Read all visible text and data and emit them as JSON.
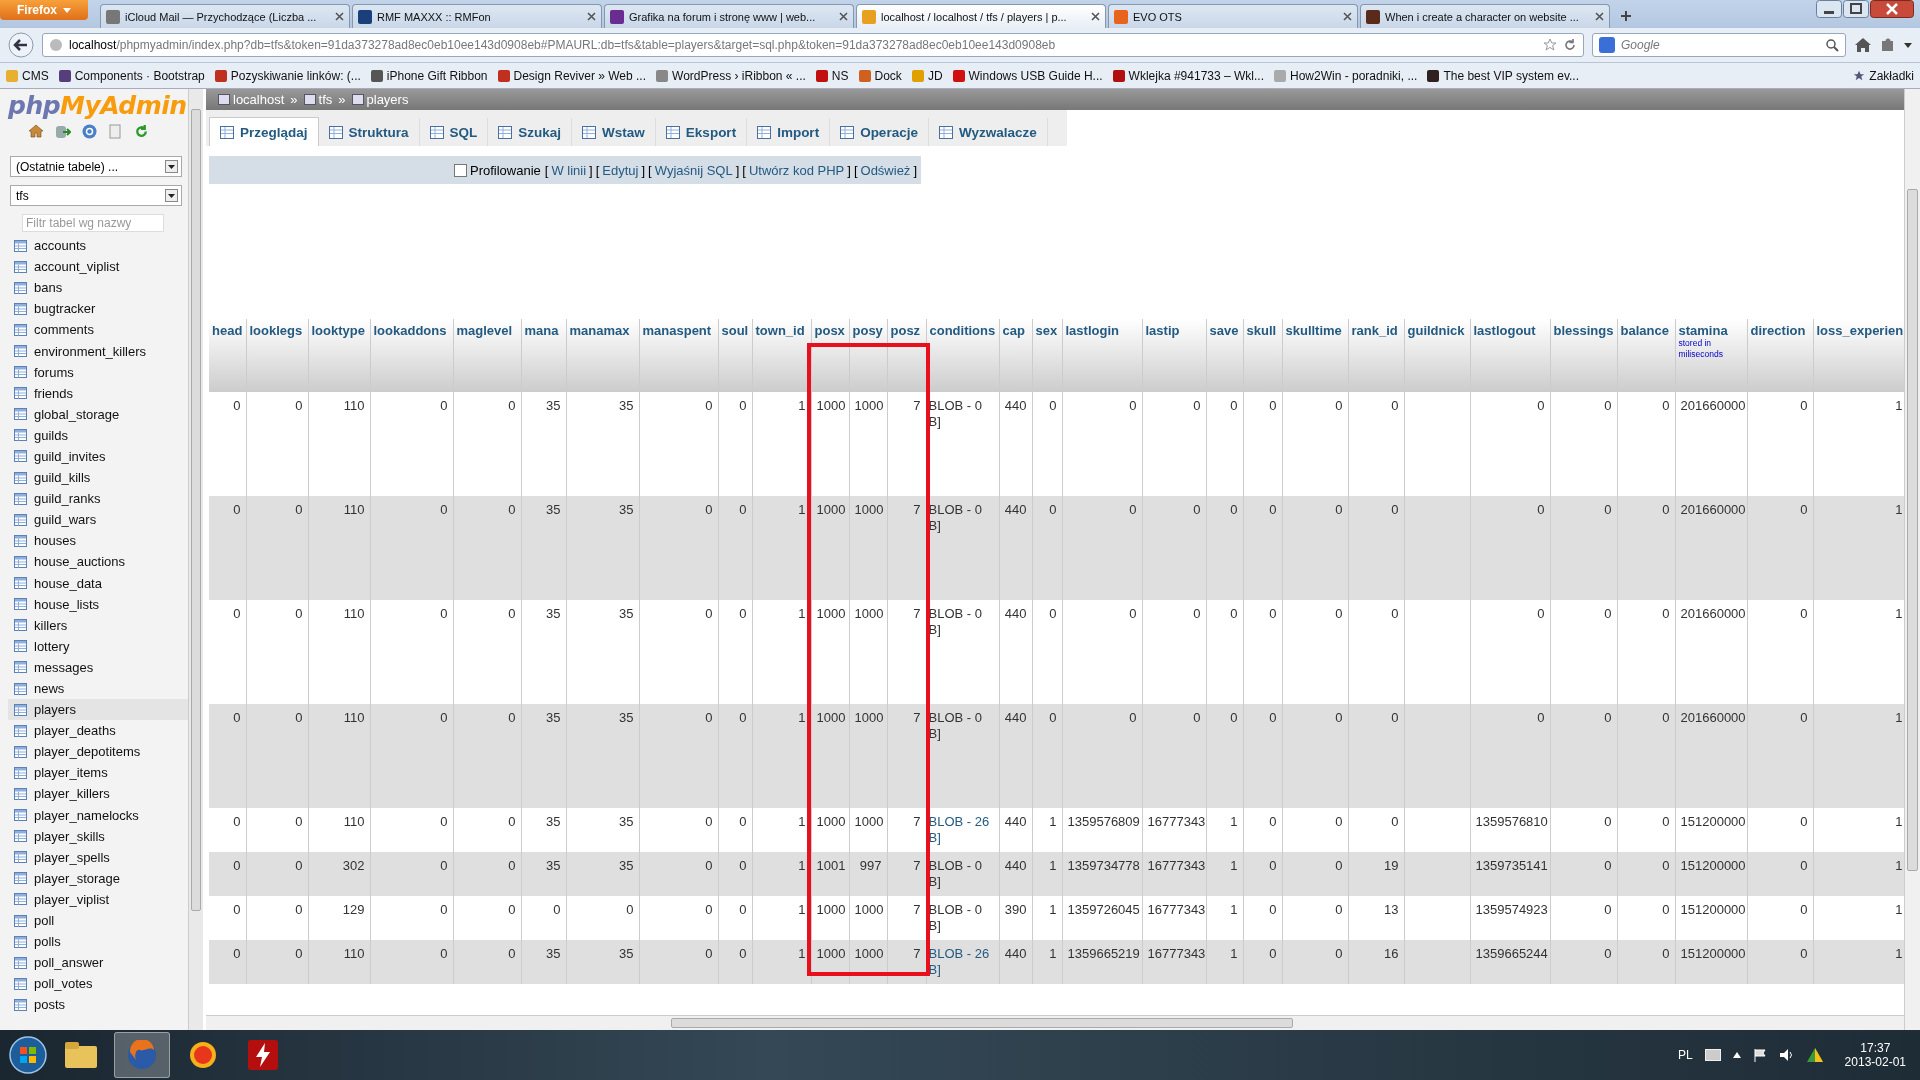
{
  "browser": {
    "app_button": "Firefox",
    "tabs": [
      {
        "title": "iCloud Mail — Przychodzące (Liczba ...",
        "selected": false
      },
      {
        "title": "RMF MAXXX :: RMFon",
        "selected": false
      },
      {
        "title": "Grafika na forum i stronę www | web...",
        "selected": false
      },
      {
        "title": "localhost / localhost / tfs / players | p...",
        "selected": true
      },
      {
        "title": "EVO OTS",
        "selected": false
      },
      {
        "title": "When i create a character on website ...",
        "selected": false
      }
    ],
    "url_host": "localhost",
    "url_rest": "/phpmyadmin/index.php?db=tfs&token=91da373278ad8ec0eb10ee143d0908eb#PMAURL:db=tfs&table=players&target=sql.php&token=91da373278ad8ec0eb10ee143d0908eb",
    "search_placeholder": "Google",
    "bookmarks": [
      "CMS",
      "Components · Bootstrap",
      "Pozyskiwanie linków: (...",
      "iPhone Gift Ribbon",
      "Design Reviver » Web ...",
      "WordPress › iRibbon « ...",
      "NS",
      "Dock",
      "JD",
      "Windows USB Guide H...",
      "Wklejka #941733 – Wkl...",
      "How2Win - poradniki, ...",
      "The best VIP system ev..."
    ],
    "bookmarks_menu": "Zakładki"
  },
  "sidebar": {
    "logo": [
      "php",
      "MyAdmin"
    ],
    "recent_select": "(Ostatnie tabele) ...",
    "db_select": "tfs",
    "filter_placeholder": "Filtr tabel wg nazwy",
    "tables": [
      {
        "name": "accounts",
        "selected": false
      },
      {
        "name": "account_viplist",
        "selected": false
      },
      {
        "name": "bans",
        "selected": false
      },
      {
        "name": "bugtracker",
        "selected": false
      },
      {
        "name": "comments",
        "selected": false
      },
      {
        "name": "environment_killers",
        "selected": false
      },
      {
        "name": "forums",
        "selected": false
      },
      {
        "name": "friends",
        "selected": false
      },
      {
        "name": "global_storage",
        "selected": false
      },
      {
        "name": "guilds",
        "selected": false
      },
      {
        "name": "guild_invites",
        "selected": false
      },
      {
        "name": "guild_kills",
        "selected": false
      },
      {
        "name": "guild_ranks",
        "selected": false
      },
      {
        "name": "guild_wars",
        "selected": false
      },
      {
        "name": "houses",
        "selected": false
      },
      {
        "name": "house_auctions",
        "selected": false
      },
      {
        "name": "house_data",
        "selected": false
      },
      {
        "name": "house_lists",
        "selected": false
      },
      {
        "name": "killers",
        "selected": false
      },
      {
        "name": "lottery",
        "selected": false
      },
      {
        "name": "messages",
        "selected": false
      },
      {
        "name": "news",
        "selected": false
      },
      {
        "name": "players",
        "selected": true
      },
      {
        "name": "player_deaths",
        "selected": false
      },
      {
        "name": "player_depotitems",
        "selected": false
      },
      {
        "name": "player_items",
        "selected": false
      },
      {
        "name": "player_killers",
        "selected": false
      },
      {
        "name": "player_namelocks",
        "selected": false
      },
      {
        "name": "player_skills",
        "selected": false
      },
      {
        "name": "player_spells",
        "selected": false
      },
      {
        "name": "player_storage",
        "selected": false
      },
      {
        "name": "player_viplist",
        "selected": false
      },
      {
        "name": "poll",
        "selected": false
      },
      {
        "name": "polls",
        "selected": false
      },
      {
        "name": "poll_answer",
        "selected": false
      },
      {
        "name": "poll_votes",
        "selected": false
      },
      {
        "name": "posts",
        "selected": false
      }
    ]
  },
  "breadcrumb": [
    "localhost",
    "tfs",
    "players"
  ],
  "breadcrumb_separator": "»",
  "tabs": [
    {
      "label": "Przeglądaj",
      "selected": true
    },
    {
      "label": "Struktura",
      "selected": false
    },
    {
      "label": "SQL",
      "selected": false
    },
    {
      "label": "Szukaj",
      "selected": false
    },
    {
      "label": "Wstaw",
      "selected": false
    },
    {
      "label": "Eksport",
      "selected": false
    },
    {
      "label": "Import",
      "selected": false
    },
    {
      "label": "Operacje",
      "selected": false
    },
    {
      "label": "Wyzwalacze",
      "selected": false
    }
  ],
  "profiling": {
    "label": "Profilowanie",
    "checked": false,
    "brackets": [
      "[",
      "]"
    ],
    "links": [
      "W linii",
      "Edytuj",
      "Wyjaśnij SQL",
      "Utwórz kod PHP",
      "Odśwież"
    ]
  },
  "table": {
    "columns": [
      {
        "name": "head"
      },
      {
        "name": "looklegs"
      },
      {
        "name": "looktype"
      },
      {
        "name": "lookaddons"
      },
      {
        "name": "maglevel"
      },
      {
        "name": "mana"
      },
      {
        "name": "manamax"
      },
      {
        "name": "manaspent"
      },
      {
        "name": "soul"
      },
      {
        "name": "town_id"
      },
      {
        "name": "posx",
        "highlighted": true
      },
      {
        "name": "posy",
        "highlighted": true
      },
      {
        "name": "posz",
        "highlighted": true
      },
      {
        "name": "conditions"
      },
      {
        "name": "cap"
      },
      {
        "name": "sex"
      },
      {
        "name": "lastlogin"
      },
      {
        "name": "lastip"
      },
      {
        "name": "save"
      },
      {
        "name": "skull"
      },
      {
        "name": "skulltime"
      },
      {
        "name": "rank_id"
      },
      {
        "name": "guildnick"
      },
      {
        "name": "lastlogout"
      },
      {
        "name": "blessings"
      },
      {
        "name": "balance"
      },
      {
        "name": "stamina",
        "note": "stored in miliseconds"
      },
      {
        "name": "direction"
      },
      {
        "name": "loss_experien"
      }
    ],
    "rows": [
      {
        "tall": true,
        "cells": [
          "0",
          "0",
          "110",
          "0",
          "0",
          "35",
          "35",
          "0",
          "0",
          "1",
          "1000",
          "1000",
          "7",
          {
            "text": "BLOB - 0 B]",
            "link": false
          },
          "440",
          "0",
          "0",
          "0",
          "0",
          "0",
          "0",
          "0",
          null,
          "0",
          "0",
          "0",
          "201660000",
          "0",
          "1"
        ]
      },
      {
        "tall": true,
        "cells": [
          "0",
          "0",
          "110",
          "0",
          "0",
          "35",
          "35",
          "0",
          "0",
          "1",
          "1000",
          "1000",
          "7",
          {
            "text": "BLOB - 0 B]",
            "link": false
          },
          "440",
          "0",
          "0",
          "0",
          "0",
          "0",
          "0",
          "0",
          null,
          "0",
          "0",
          "0",
          "201660000",
          "0",
          "1"
        ]
      },
      {
        "tall": true,
        "cells": [
          "0",
          "0",
          "110",
          "0",
          "0",
          "35",
          "35",
          "0",
          "0",
          "1",
          "1000",
          "1000",
          "7",
          {
            "text": "BLOB - 0 B]",
            "link": false
          },
          "440",
          "0",
          "0",
          "0",
          "0",
          "0",
          "0",
          "0",
          null,
          "0",
          "0",
          "0",
          "201660000",
          "0",
          "1"
        ]
      },
      {
        "tall": true,
        "cells": [
          "0",
          "0",
          "110",
          "0",
          "0",
          "35",
          "35",
          "0",
          "0",
          "1",
          "1000",
          "1000",
          "7",
          {
            "text": "BLOB - 0 B]",
            "link": false
          },
          "440",
          "0",
          "0",
          "0",
          "0",
          "0",
          "0",
          "0",
          null,
          "0",
          "0",
          "0",
          "201660000",
          "0",
          "1"
        ]
      },
      {
        "tall": false,
        "cells": [
          "0",
          "0",
          "110",
          "0",
          "0",
          "35",
          "35",
          "0",
          "0",
          "1",
          "1000",
          "1000",
          "7",
          {
            "text": "BLOB - 26 B]",
            "link": true
          },
          "440",
          "1",
          "1359576809",
          "16777343",
          "1",
          "0",
          "0",
          "0",
          null,
          "1359576810",
          "0",
          "0",
          "151200000",
          "0",
          "1"
        ]
      },
      {
        "tall": false,
        "cells": [
          "0",
          "0",
          "302",
          "0",
          "0",
          "35",
          "35",
          "0",
          "0",
          "1",
          "1001",
          "997",
          "7",
          {
            "text": "BLOB - 0 B]",
            "link": false
          },
          "440",
          "1",
          "1359734778",
          "16777343",
          "1",
          "0",
          "0",
          "19",
          null,
          "1359735141",
          "0",
          "0",
          "151200000",
          "0",
          "1"
        ]
      },
      {
        "tall": false,
        "cells": [
          "0",
          "0",
          "129",
          "0",
          "0",
          "0",
          "0",
          "0",
          "0",
          "1",
          "1000",
          "1000",
          "7",
          {
            "text": "BLOB - 0 B]",
            "link": false
          },
          "390",
          "1",
          "1359726045",
          "16777343",
          "1",
          "0",
          "0",
          "13",
          null,
          "1359574923",
          "0",
          "0",
          "151200000",
          "0",
          "1"
        ]
      },
      {
        "tall": false,
        "cells": [
          "0",
          "0",
          "110",
          "0",
          "0",
          "35",
          "35",
          "0",
          "0",
          "1",
          "1000",
          "1000",
          "7",
          {
            "text": "BLOB - 26 B]",
            "link": true
          },
          "440",
          "1",
          "1359665219",
          "16777343",
          "1",
          "0",
          "0",
          "16",
          null,
          "1359665244",
          "0",
          "0",
          "151200000",
          "0",
          "1"
        ]
      }
    ]
  },
  "taskbar": {
    "language": "PL",
    "time": "17:37",
    "date": "2013-02-01"
  }
}
